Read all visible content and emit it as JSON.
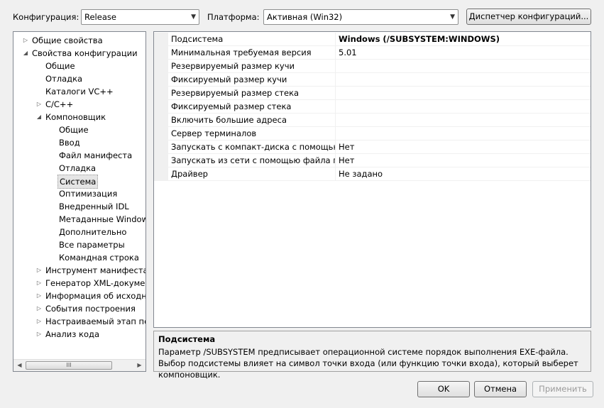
{
  "toolbar": {
    "config_label": "Конфигурация:",
    "config_value": "Release",
    "platform_label": "Платформа:",
    "platform_value": "Активная (Win32)",
    "config_manager_button": "Диспетчер конфигураций..."
  },
  "tree": {
    "items": [
      {
        "label": "Общие свойства",
        "expander": "collapsed"
      },
      {
        "label": "Свойства конфигурации",
        "expander": "expanded"
      },
      {
        "label": "Общие",
        "expander": "none"
      },
      {
        "label": "Отладка",
        "expander": "none"
      },
      {
        "label": "Каталоги VC++",
        "expander": "none"
      },
      {
        "label": "C/C++",
        "expander": "collapsed"
      },
      {
        "label": "Компоновщик",
        "expander": "expanded"
      },
      {
        "label": "Общие",
        "expander": "none"
      },
      {
        "label": "Ввод",
        "expander": "none"
      },
      {
        "label": "Файл манифеста",
        "expander": "none"
      },
      {
        "label": "Отладка",
        "expander": "none"
      },
      {
        "label": "Система",
        "expander": "none",
        "selected": true
      },
      {
        "label": "Оптимизация",
        "expander": "none"
      },
      {
        "label": "Внедренный IDL",
        "expander": "none"
      },
      {
        "label": "Метаданные Windows",
        "expander": "none"
      },
      {
        "label": "Дополнительно",
        "expander": "none"
      },
      {
        "label": "Все параметры",
        "expander": "none"
      },
      {
        "label": "Командная строка",
        "expander": "none"
      },
      {
        "label": "Инструмент манифеста",
        "expander": "collapsed"
      },
      {
        "label": "Генератор XML-документ",
        "expander": "collapsed"
      },
      {
        "label": "Информация об исходно",
        "expander": "collapsed"
      },
      {
        "label": "События построения",
        "expander": "collapsed"
      },
      {
        "label": "Настраиваемый этап пос",
        "expander": "collapsed"
      },
      {
        "label": "Анализ кода",
        "expander": "collapsed"
      }
    ]
  },
  "properties": [
    {
      "name": "Подсистема",
      "value": "Windows (/SUBSYSTEM:WINDOWS)",
      "bold": true
    },
    {
      "name": "Минимальная требуемая версия",
      "value": "5.01"
    },
    {
      "name": "Резервируемый размер кучи",
      "value": ""
    },
    {
      "name": "Фиксируемый размер кучи",
      "value": ""
    },
    {
      "name": "Резервируемый размер стека",
      "value": ""
    },
    {
      "name": "Фиксируемый размер стека",
      "value": ""
    },
    {
      "name": "Включить большие адреса",
      "value": ""
    },
    {
      "name": "Сервер терминалов",
      "value": ""
    },
    {
      "name": "Запускать с компакт-диска с помощью ф",
      "value": "Нет"
    },
    {
      "name": "Запускать из сети с помощью файла подк",
      "value": "Нет"
    },
    {
      "name": "Драйвер",
      "value": "Не задано"
    }
  ],
  "description": {
    "title": "Подсистема",
    "text": "Параметр /SUBSYSTEM предписывает операционной системе порядок выполнения EXE-файла. Выбор подсистемы влияет на символ точки входа (или функцию точки входа), который выберет компоновщик."
  },
  "buttons": {
    "ok": "OK",
    "cancel": "Отмена",
    "apply": "Применить"
  },
  "icons": {
    "dropdown": "chevron-down-icon",
    "tree_expanded": "triangle-down-icon",
    "tree_collapsed": "triangle-right-icon",
    "scroll_left": "arrow-left-icon",
    "scroll_right": "arrow-right-icon",
    "scroll_grip": "grip-icon"
  }
}
